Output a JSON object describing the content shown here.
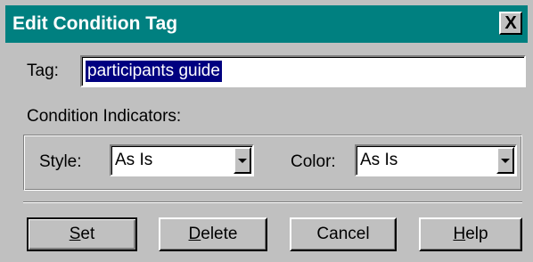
{
  "dialog": {
    "title": "Edit Condition Tag",
    "close_label": "X"
  },
  "tag": {
    "label": "Tag:",
    "value": "participants guide"
  },
  "indicators": {
    "label": "Condition Indicators:",
    "style_label": "Style:",
    "style_value": "As Is",
    "color_label": "Color:",
    "color_value": "As Is"
  },
  "buttons": {
    "set": {
      "mnemonic": "S",
      "rest": "et"
    },
    "delete": {
      "mnemonic": "D",
      "rest": "elete"
    },
    "cancel": "Cancel",
    "help": {
      "mnemonic": "H",
      "rest": "elp"
    }
  },
  "colors": {
    "titlebar": "#008080",
    "face": "#c0c0c0",
    "selection": "#000080"
  }
}
